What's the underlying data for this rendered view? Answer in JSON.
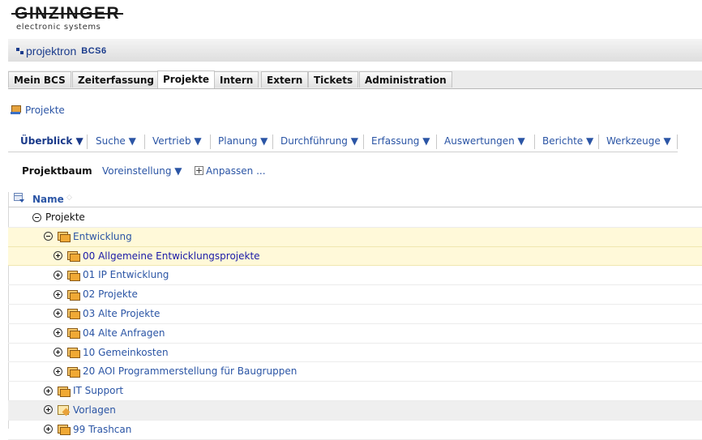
{
  "logo": {
    "main": "GINZINGER",
    "sub": "electronic systems"
  },
  "brand": {
    "name": "projektron",
    "suffix": "BCS6"
  },
  "tabs": [
    {
      "label": "Mein BCS",
      "active": false
    },
    {
      "label": "Zeiterfassung",
      "active": false
    },
    {
      "label": "Projekte",
      "active": true
    },
    {
      "label": "Intern",
      "active": false
    },
    {
      "label": "Extern",
      "active": false
    },
    {
      "label": "Tickets",
      "active": false
    },
    {
      "label": "Administration",
      "active": false
    }
  ],
  "breadcrumb": {
    "label": "Projekte",
    "icon": "project-icon"
  },
  "menu": [
    {
      "label": "Überblick ▼",
      "bold": true
    },
    {
      "label": "Suche ▼"
    },
    {
      "label": "Vertrieb ▼"
    },
    {
      "label": "Planung ▼"
    },
    {
      "label": "Durchführung ▼"
    },
    {
      "label": "Erfassung ▼"
    },
    {
      "label": "Auswertungen ▼"
    },
    {
      "label": "Berichte ▼"
    },
    {
      "label": "Werkzeuge ▼"
    }
  ],
  "subnav": {
    "title": "Projektbaum",
    "preset": "Voreinstellung ▼",
    "customize": "Anpassen ..."
  },
  "grid": {
    "column": "Name",
    "rows": [
      {
        "label": "Projekte",
        "toggle": "minus",
        "icon": "none",
        "style": "dark",
        "bg": "white"
      },
      {
        "label": "Entwicklung",
        "toggle": "minus",
        "icon": "folder",
        "style": "link",
        "bg": "highlight"
      },
      {
        "label": "00 Allgemeine Entwicklungsprojekte",
        "toggle": "plus",
        "icon": "folder",
        "style": "deep",
        "bg": "highlight"
      },
      {
        "label": "01 IP Entwicklung",
        "toggle": "plus",
        "icon": "folder",
        "style": "link",
        "bg": "white"
      },
      {
        "label": "02 Projekte",
        "toggle": "plus",
        "icon": "folder",
        "style": "link",
        "bg": "white"
      },
      {
        "label": "03 Alte Projekte",
        "toggle": "plus",
        "icon": "folder",
        "style": "link",
        "bg": "white"
      },
      {
        "label": "04 Alte Anfragen",
        "toggle": "plus",
        "icon": "folder",
        "style": "link",
        "bg": "white"
      },
      {
        "label": "10 Gemeinkosten",
        "toggle": "plus",
        "icon": "folder",
        "style": "link",
        "bg": "white"
      },
      {
        "label": "20 AOI Programmerstellung für Baugruppen",
        "toggle": "plus",
        "icon": "folder",
        "style": "link",
        "bg": "white"
      },
      {
        "label": "IT Support",
        "toggle": "plus",
        "icon": "folder",
        "style": "link",
        "bg": "white"
      },
      {
        "label": "Vorlagen",
        "toggle": "plus",
        "icon": "template",
        "style": "link",
        "bg": "grey"
      },
      {
        "label": "99 Trashcan",
        "toggle": "plus",
        "icon": "folder",
        "style": "link",
        "bg": "white"
      }
    ]
  }
}
